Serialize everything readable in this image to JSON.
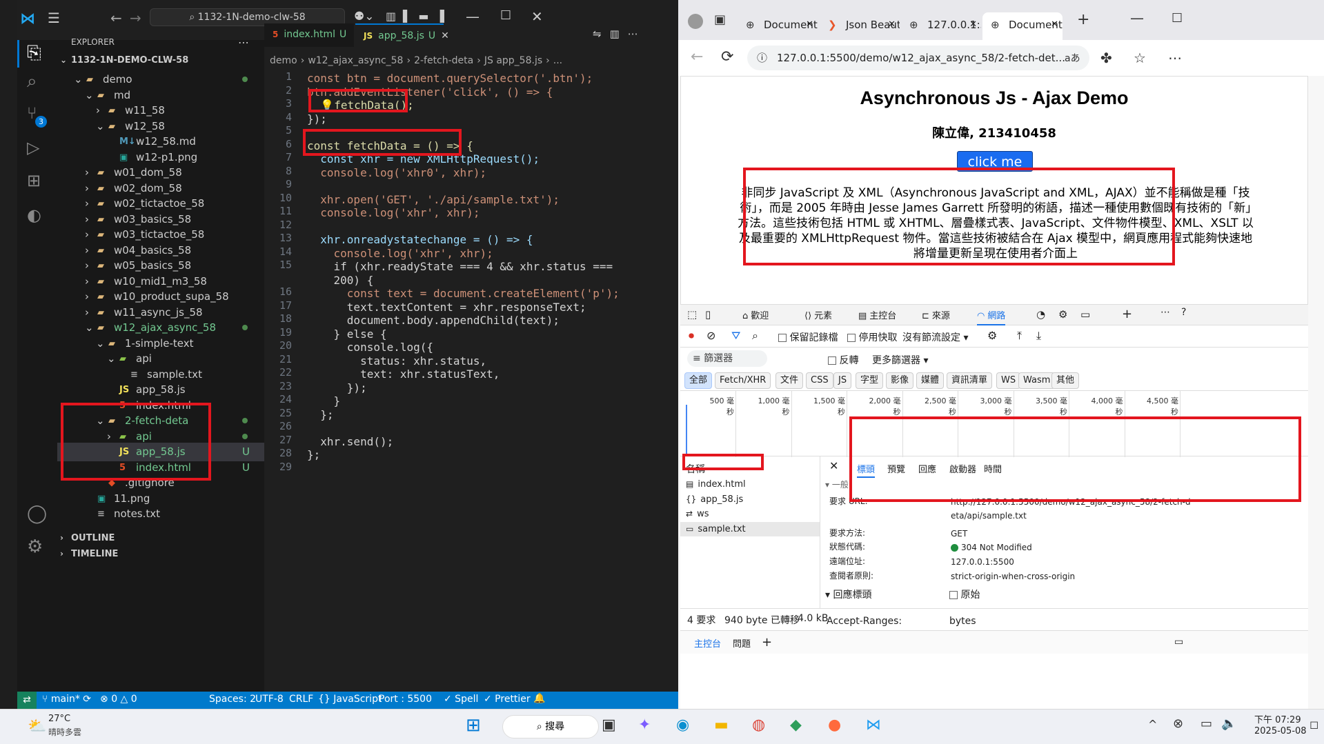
{
  "vscode": {
    "search_title": "1132-1N-demo-clw-58",
    "explorer_label": "EXPLORER",
    "project_name": "1132-1N-DEMO-CLW-58",
    "source_control_badge": "3",
    "tree": [
      {
        "label": "demo",
        "depth": 1,
        "type": "folder",
        "open": true,
        "dot": true
      },
      {
        "label": "md",
        "depth": 2,
        "type": "folder",
        "open": true
      },
      {
        "label": "w11_58",
        "depth": 3,
        "type": "folder",
        "open": false
      },
      {
        "label": "w12_58",
        "depth": 3,
        "type": "folder",
        "open": true
      },
      {
        "label": "w12_58.md",
        "depth": 4,
        "type": "md"
      },
      {
        "label": "w12-p1.png",
        "depth": 4,
        "type": "img"
      },
      {
        "label": "w01_dom_58",
        "depth": 2,
        "type": "folder",
        "open": false
      },
      {
        "label": "w02_dom_58",
        "depth": 2,
        "type": "folder",
        "open": false
      },
      {
        "label": "w02_tictactoe_58",
        "depth": 2,
        "type": "folder",
        "open": false
      },
      {
        "label": "w03_basics_58",
        "depth": 2,
        "type": "folder",
        "open": false
      },
      {
        "label": "w03_tictactoe_58",
        "depth": 2,
        "type": "folder",
        "open": false
      },
      {
        "label": "w04_basics_58",
        "depth": 2,
        "type": "folder",
        "open": false
      },
      {
        "label": "w05_basics_58",
        "depth": 2,
        "type": "folder",
        "open": false
      },
      {
        "label": "w10_mid1_m3_58",
        "depth": 2,
        "type": "folder",
        "open": false
      },
      {
        "label": "w10_product_supa_58",
        "depth": 2,
        "type": "folder",
        "open": false
      },
      {
        "label": "w11_async_js_58",
        "depth": 2,
        "type": "folder",
        "open": false
      },
      {
        "label": "w12_ajax_async_58",
        "depth": 2,
        "type": "folder",
        "open": true,
        "green": true,
        "dot": true
      },
      {
        "label": "1-simple-text",
        "depth": 3,
        "type": "folder",
        "open": true
      },
      {
        "label": "api",
        "depth": 4,
        "type": "apifolder",
        "open": true
      },
      {
        "label": "sample.txt",
        "depth": 5,
        "type": "txt"
      },
      {
        "label": "app_58.js",
        "depth": 4,
        "type": "js"
      },
      {
        "label": "index.html",
        "depth": 4,
        "type": "html"
      },
      {
        "label": "2-fetch-deta",
        "depth": 3,
        "type": "folder",
        "open": true,
        "green": true,
        "dot": true
      },
      {
        "label": "api",
        "depth": 4,
        "type": "apifolder",
        "open": false,
        "green": true,
        "dot": true
      },
      {
        "label": "app_58.js",
        "depth": 4,
        "type": "js",
        "green": true,
        "u": "U",
        "selected": true
      },
      {
        "label": "index.html",
        "depth": 4,
        "type": "html",
        "green": true,
        "u": "U"
      },
      {
        "label": ".gitignore",
        "depth": 3,
        "type": "git"
      },
      {
        "label": "11.png",
        "depth": 2,
        "type": "img"
      },
      {
        "label": "notes.txt",
        "depth": 2,
        "type": "txt"
      }
    ],
    "outline_label": "OUTLINE",
    "timeline_label": "TIMELINE",
    "tabs": [
      {
        "label": "index.html",
        "suffix": "U",
        "active": false
      },
      {
        "label": "app_58.js",
        "suffix": "U",
        "active": true
      }
    ],
    "breadcrumb": [
      "demo",
      "w12_ajax_async_58",
      "2-fetch-deta",
      "JS app_58.js",
      "..."
    ],
    "code": [
      "const btn = document.querySelector('.btn');",
      "btn.addEventListener('click', () => {",
      "  💡fetchData();",
      "});",
      "",
      "const fetchData = () => {",
      "  const xhr = new XMLHttpRequest();",
      "  console.log('xhr0', xhr);",
      "",
      "  xhr.open('GET', './api/sample.txt');",
      "  console.log('xhr', xhr);",
      "",
      "  xhr.onreadystatechange = () => {",
      "    console.log('xhr', xhr);",
      "    if (xhr.readyState === 4 && xhr.status ===",
      "    200) {",
      "      const text = document.createElement('p');",
      "      text.textContent = xhr.responseText;",
      "      document.body.appendChild(text);",
      "    } else {",
      "      console.log({",
      "        status: xhr.status,",
      "        text: xhr.statusText,",
      "      });",
      "    }",
      "  };",
      "",
      "  xhr.send();",
      "};",
      ""
    ],
    "line_numbers": [
      "1",
      "2",
      "3",
      "4",
      "5",
      "6",
      "7",
      "8",
      "9",
      "10",
      "11",
      "12",
      "13",
      "14",
      "15",
      "",
      "16",
      "17",
      "18",
      "19",
      "20",
      "21",
      "22",
      "23",
      "24",
      "25",
      "26",
      "27",
      "28",
      "29"
    ],
    "status": {
      "branch": "main*",
      "errors": "0",
      "warnings": "0",
      "spaces": "Spaces: 2",
      "encoding": "UTF-8",
      "eol": "CRLF",
      "language": "{} JavaScript",
      "port": "Port : 5500",
      "spell": "✓ Spell",
      "prettier": "✓ Prettier"
    }
  },
  "browser": {
    "tabs": [
      {
        "label": "Document"
      },
      {
        "label": "Json Beaut"
      },
      {
        "label": "127.0.0.1:5"
      },
      {
        "label": "Document",
        "active": true
      }
    ],
    "url": "127.0.0.1:5500/demo/w12_ajax_async_58/2-fetch-det...",
    "page": {
      "heading": "Asynchronous Js - Ajax Demo",
      "author": "陳立偉, 213410458",
      "button": "click me",
      "paragraph": "非同步 JavaScript 及 XML（Asynchronous JavaScript and XML，AJAX）並不能稱做是種「技術」，而是 2005 年時由 Jesse James Garrett 所發明的術語，描述一種使用數個既有技術的「新」方法。這些技術包括 HTML 或 XHTML、層疊樣式表、JavaScript、文件物件模型、XML、XSLT 以及最重要的 XMLHttpRequest 物件。當這些技術被結合在 Ajax 模型中，網頁應用程式能夠快速地將增量更新呈現在使用者介面上"
    },
    "devtools": {
      "tabs": [
        "歡迎",
        "元素",
        "主控台",
        "來源",
        "網路"
      ],
      "preserve_log": "保留記錄檔",
      "disable_cache": "停用快取",
      "no_throttle": "沒有節流設定",
      "filter_placeholder": "篩選器",
      "invert": "反轉",
      "more_filters": "更多篩選器",
      "type_filters": [
        "全部",
        "Fetch/XHR",
        "文件",
        "CSS",
        "JS",
        "字型",
        "影像",
        "媒體",
        "資訊清單",
        "WS",
        "Wasm",
        "其他"
      ],
      "timeline_ticks": [
        "500 毫秒",
        "1,000 毫秒",
        "1,500 毫秒",
        "2,000 毫秒",
        "2,500 毫秒",
        "3,000 毫秒",
        "3,500 毫秒",
        "4,000 毫秒",
        "4,500 毫秒"
      ],
      "name_header": "名稱",
      "requests": [
        "index.html",
        "app_58.js",
        "ws",
        "sample.txt"
      ],
      "detail_tabs": [
        "標頭",
        "預覽",
        "回應",
        "啟動器",
        "時間"
      ],
      "general_label": "一般",
      "headers": [
        {
          "k": "要求 URL:",
          "v": "http://127.0.0.1:5500/demo/w12_ajax_async_58/2-fetch-deta/api/sample.txt"
        },
        {
          "k": "要求方法:",
          "v": "GET"
        },
        {
          "k": "狀態代碼:",
          "v": "304 Not Modified"
        },
        {
          "k": "遠端位址:",
          "v": "127.0.0.1:5500"
        },
        {
          "k": "查閱者原則:",
          "v": "strict-origin-when-cross-origin"
        }
      ],
      "response_headers": "回應標頭",
      "raw": "原始",
      "accept_ranges_k": "Accept-Ranges:",
      "accept_ranges_v": "bytes",
      "summary_requests": "4 要求",
      "summary_transferred": "940 byte 已轉移",
      "summary_size": "4.0 kB",
      "bottom_tabs": [
        "主控台",
        "問題"
      ]
    }
  },
  "taskbar": {
    "temp": "27°C",
    "weather": "晴時多雲",
    "search": "搜尋",
    "time": "下午 07:29",
    "date": "2025-05-08"
  }
}
